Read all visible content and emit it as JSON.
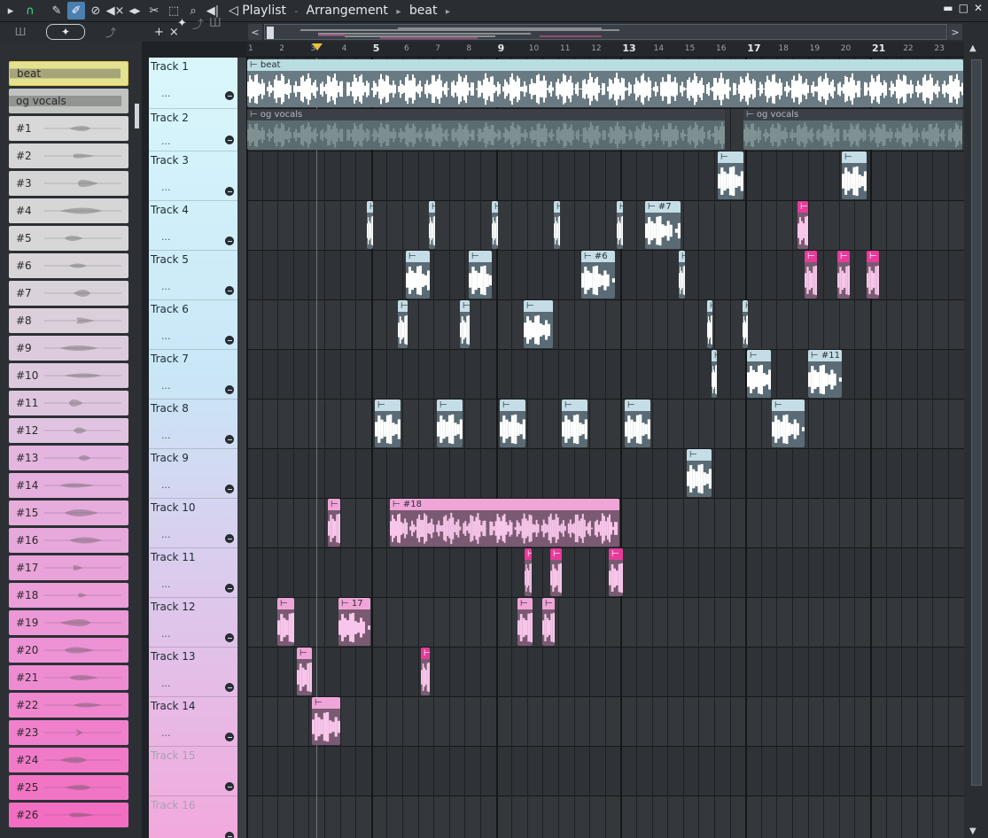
{
  "title": {
    "window": "Playlist",
    "view": "Arrangement",
    "pattern": "beat"
  },
  "toolbar_icons": [
    "play-icon",
    "magnet-icon",
    "pencil-icon",
    "brush-icon",
    "delete-icon",
    "mute-icon",
    "slip-icon",
    "slice-icon",
    "select-icon",
    "zoom-icon",
    "playback-icon"
  ],
  "window_controls": {
    "minimize": "▬",
    "maximize": "□",
    "close": "✕"
  },
  "browser_tabs": {
    "piano": "Ш",
    "audio": "✦",
    "automation": "⤴"
  },
  "track_tools": {
    "add": "+",
    "delete": "×"
  },
  "ruler_marks": [
    {
      "n": 1,
      "major": false
    },
    {
      "n": 2,
      "major": false
    },
    {
      "n": 3,
      "major": false
    },
    {
      "n": 4,
      "major": false
    },
    {
      "n": 5,
      "major": true
    },
    {
      "n": 6,
      "major": false
    },
    {
      "n": 7,
      "major": false
    },
    {
      "n": 8,
      "major": false
    },
    {
      "n": 9,
      "major": true
    },
    {
      "n": 10,
      "major": false
    },
    {
      "n": 11,
      "major": false
    },
    {
      "n": 12,
      "major": false
    },
    {
      "n": 13,
      "major": true
    },
    {
      "n": 14,
      "major": false
    },
    {
      "n": 15,
      "major": false
    },
    {
      "n": 16,
      "major": false
    },
    {
      "n": 17,
      "major": true
    },
    {
      "n": 18,
      "major": false
    },
    {
      "n": 19,
      "major": false
    },
    {
      "n": 20,
      "major": false
    },
    {
      "n": 21,
      "major": true
    },
    {
      "n": 22,
      "major": false
    },
    {
      "n": 23,
      "major": false
    }
  ],
  "browser_clips": [
    "beat",
    "og vocals",
    "#1",
    "#2",
    "#3",
    "#4",
    "#5",
    "#6",
    "#7",
    "#8",
    "#9",
    "#10",
    "#11",
    "#12",
    "#13",
    "#14",
    "#15",
    "#16",
    "#17",
    "#18",
    "#19",
    "#20",
    "#21",
    "#22",
    "#23",
    "#24",
    "#25",
    "#26"
  ],
  "tracks": [
    {
      "name": "Track 1",
      "dots": "...",
      "active": true
    },
    {
      "name": "Track 2",
      "dots": "...",
      "active": true
    },
    {
      "name": "Track 3",
      "dots": "...",
      "active": true
    },
    {
      "name": "Track 4",
      "dots": "...",
      "active": true
    },
    {
      "name": "Track 5",
      "dots": "...",
      "active": true
    },
    {
      "name": "Track 6",
      "dots": "...",
      "active": true
    },
    {
      "name": "Track 7",
      "dots": "...",
      "active": true
    },
    {
      "name": "Track 8",
      "dots": "...",
      "active": true
    },
    {
      "name": "Track 9",
      "dots": "...",
      "active": true
    },
    {
      "name": "Track 10",
      "dots": "...",
      "active": true
    },
    {
      "name": "Track 11",
      "dots": "...",
      "active": true
    },
    {
      "name": "Track 12",
      "dots": "...",
      "active": true
    },
    {
      "name": "Track 13",
      "dots": "...",
      "active": true
    },
    {
      "name": "Track 14",
      "dots": "...",
      "active": true
    },
    {
      "name": "Track 15",
      "dots": "",
      "active": false
    },
    {
      "name": "Track 16",
      "dots": "",
      "active": false
    }
  ],
  "clip_labels": {
    "beat": "beat",
    "og_vocals": "og vocals",
    "c7": "#7",
    "c6": "#6",
    "c11": "#11",
    "c18": "#18",
    "c17": "17"
  }
}
